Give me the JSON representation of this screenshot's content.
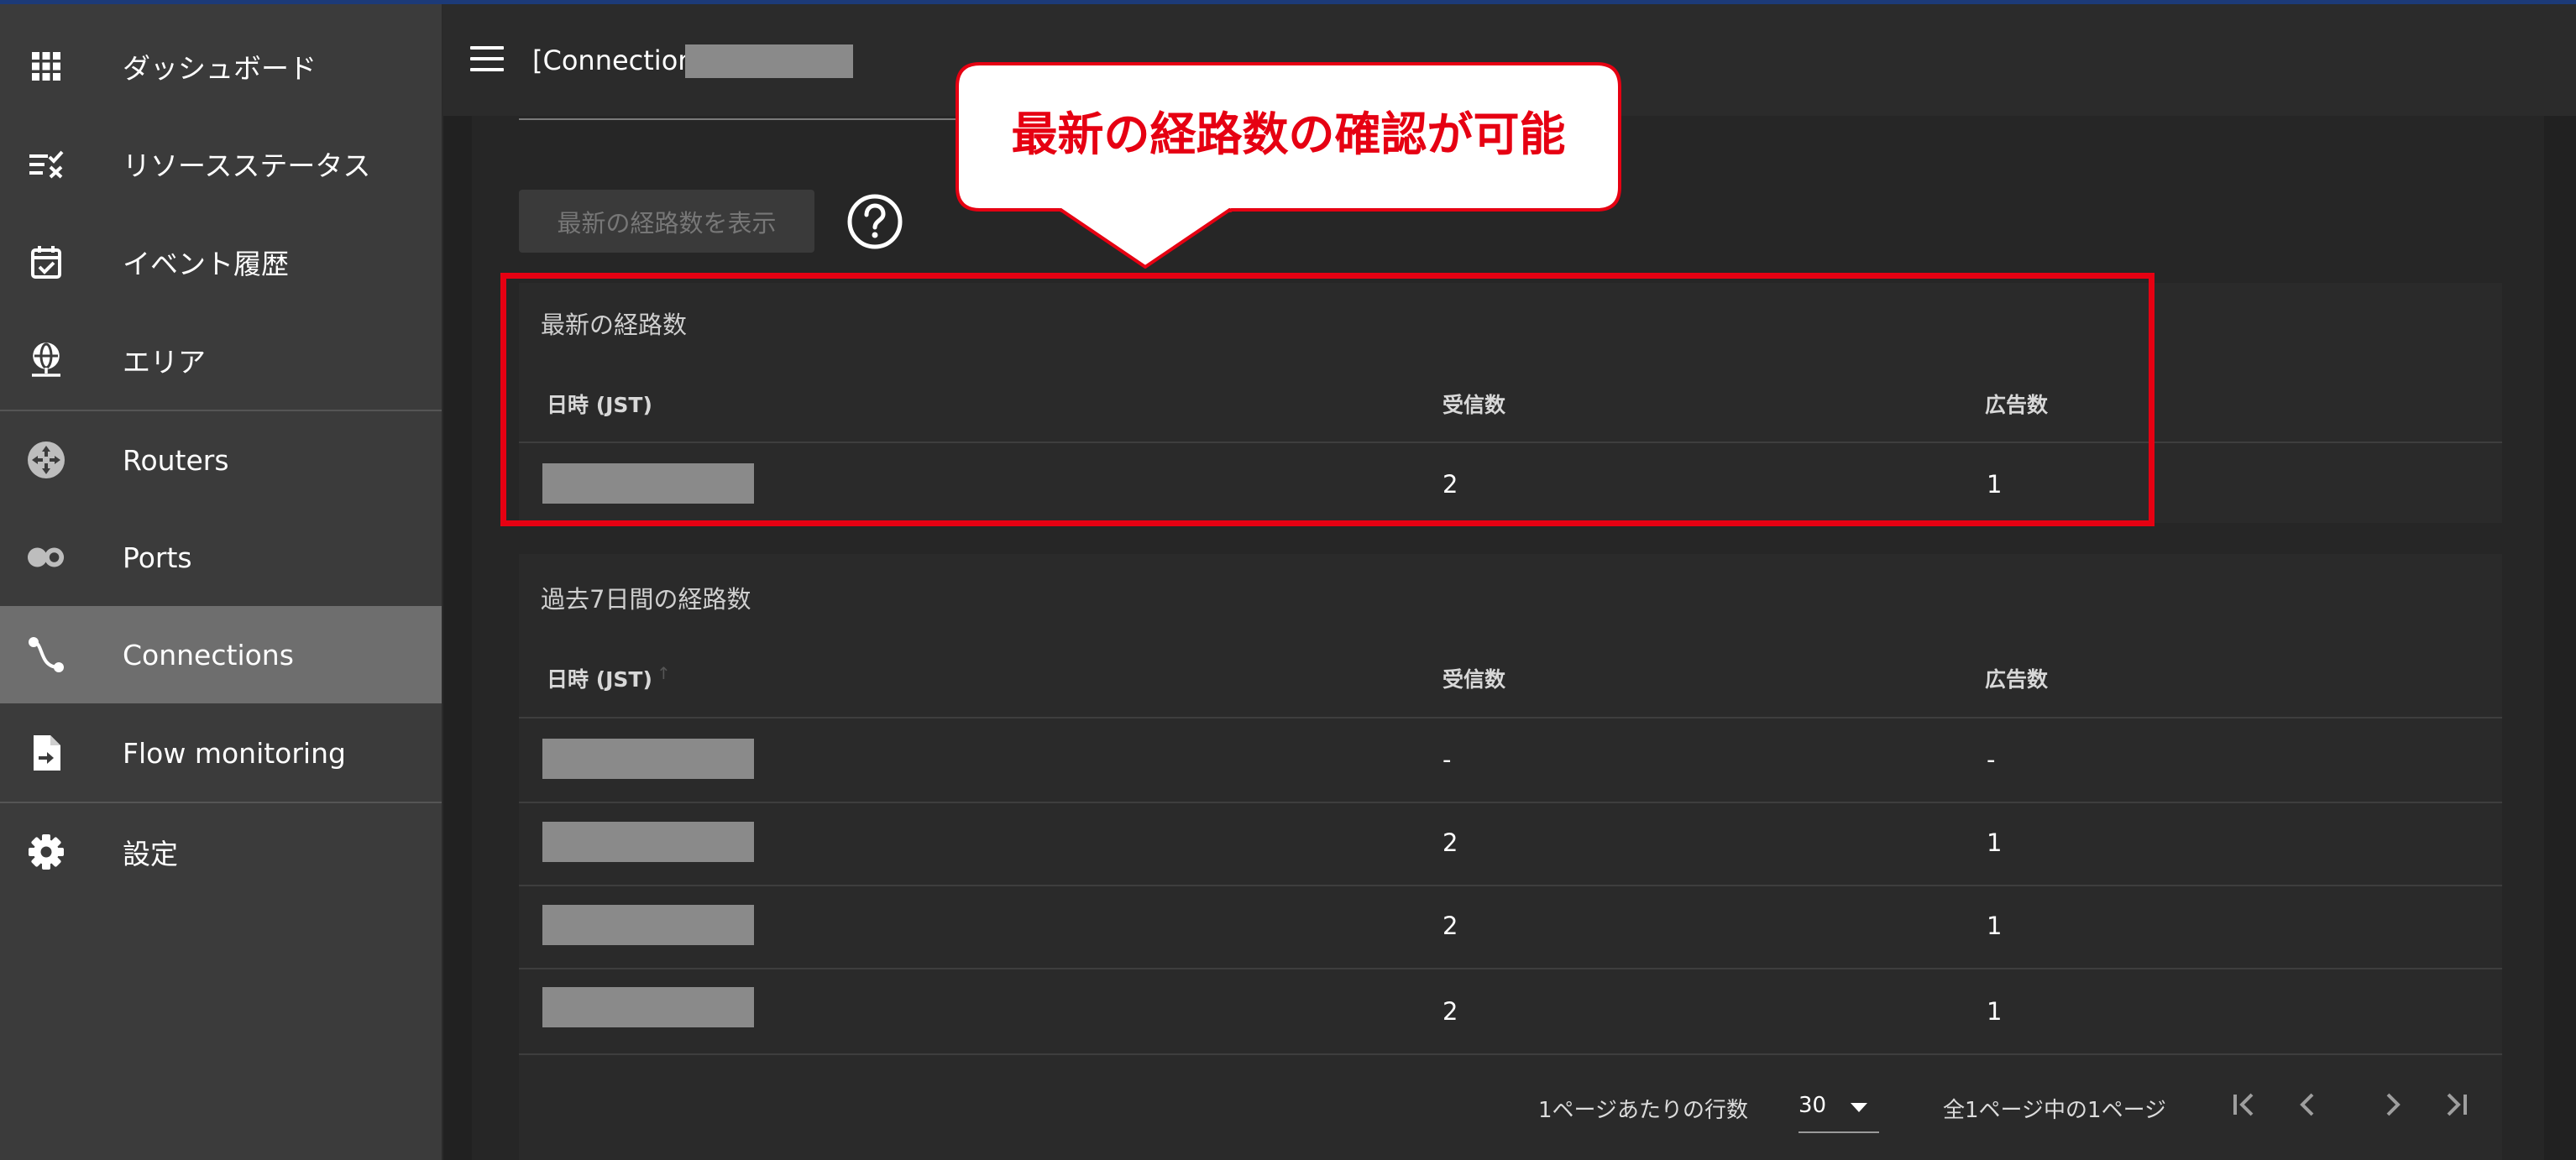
{
  "sidebar": {
    "items": [
      {
        "label": "ダッシュボード",
        "icon": "grid-icon"
      },
      {
        "label": "リソースステータス",
        "icon": "checklist-icon"
      },
      {
        "label": "イベント履歴",
        "icon": "calendar-check-icon"
      },
      {
        "label": "エリア",
        "icon": "globe-icon"
      },
      {
        "label": "Routers",
        "icon": "router-icon"
      },
      {
        "label": "Ports",
        "icon": "ports-icon"
      },
      {
        "label": "Connections",
        "icon": "connection-icon"
      },
      {
        "label": "Flow monitoring",
        "icon": "file-arrow-icon"
      },
      {
        "label": "設定",
        "icon": "gear-icon"
      }
    ],
    "active": "Connections"
  },
  "header": {
    "title": "[Connection]"
  },
  "actions": {
    "show_latest_label": "最新の経路数を表示"
  },
  "callout": {
    "text": "最新の経路数の確認が可能"
  },
  "latest": {
    "title": "最新の経路数",
    "columns": [
      "日時 (JST)",
      "受信数",
      "広告数"
    ],
    "rows": [
      {
        "received": "2",
        "advertised": "1"
      }
    ]
  },
  "history": {
    "title": "過去7日間の経路数",
    "columns": [
      "日時 (JST)",
      "受信数",
      "広告数"
    ],
    "rows": [
      {
        "received": "-",
        "advertised": "-"
      },
      {
        "received": "2",
        "advertised": "1"
      },
      {
        "received": "2",
        "advertised": "1"
      },
      {
        "received": "2",
        "advertised": "1"
      }
    ]
  },
  "pagination": {
    "rows_per_page_label": "1ページあたりの行数",
    "rows_per_page": "30",
    "page_info": "全1ページ中の1ページ"
  },
  "colors": {
    "accent_red": "#e60012",
    "sidebar_bg": "#3b3b3b",
    "active_bg": "#6e6e6e"
  }
}
